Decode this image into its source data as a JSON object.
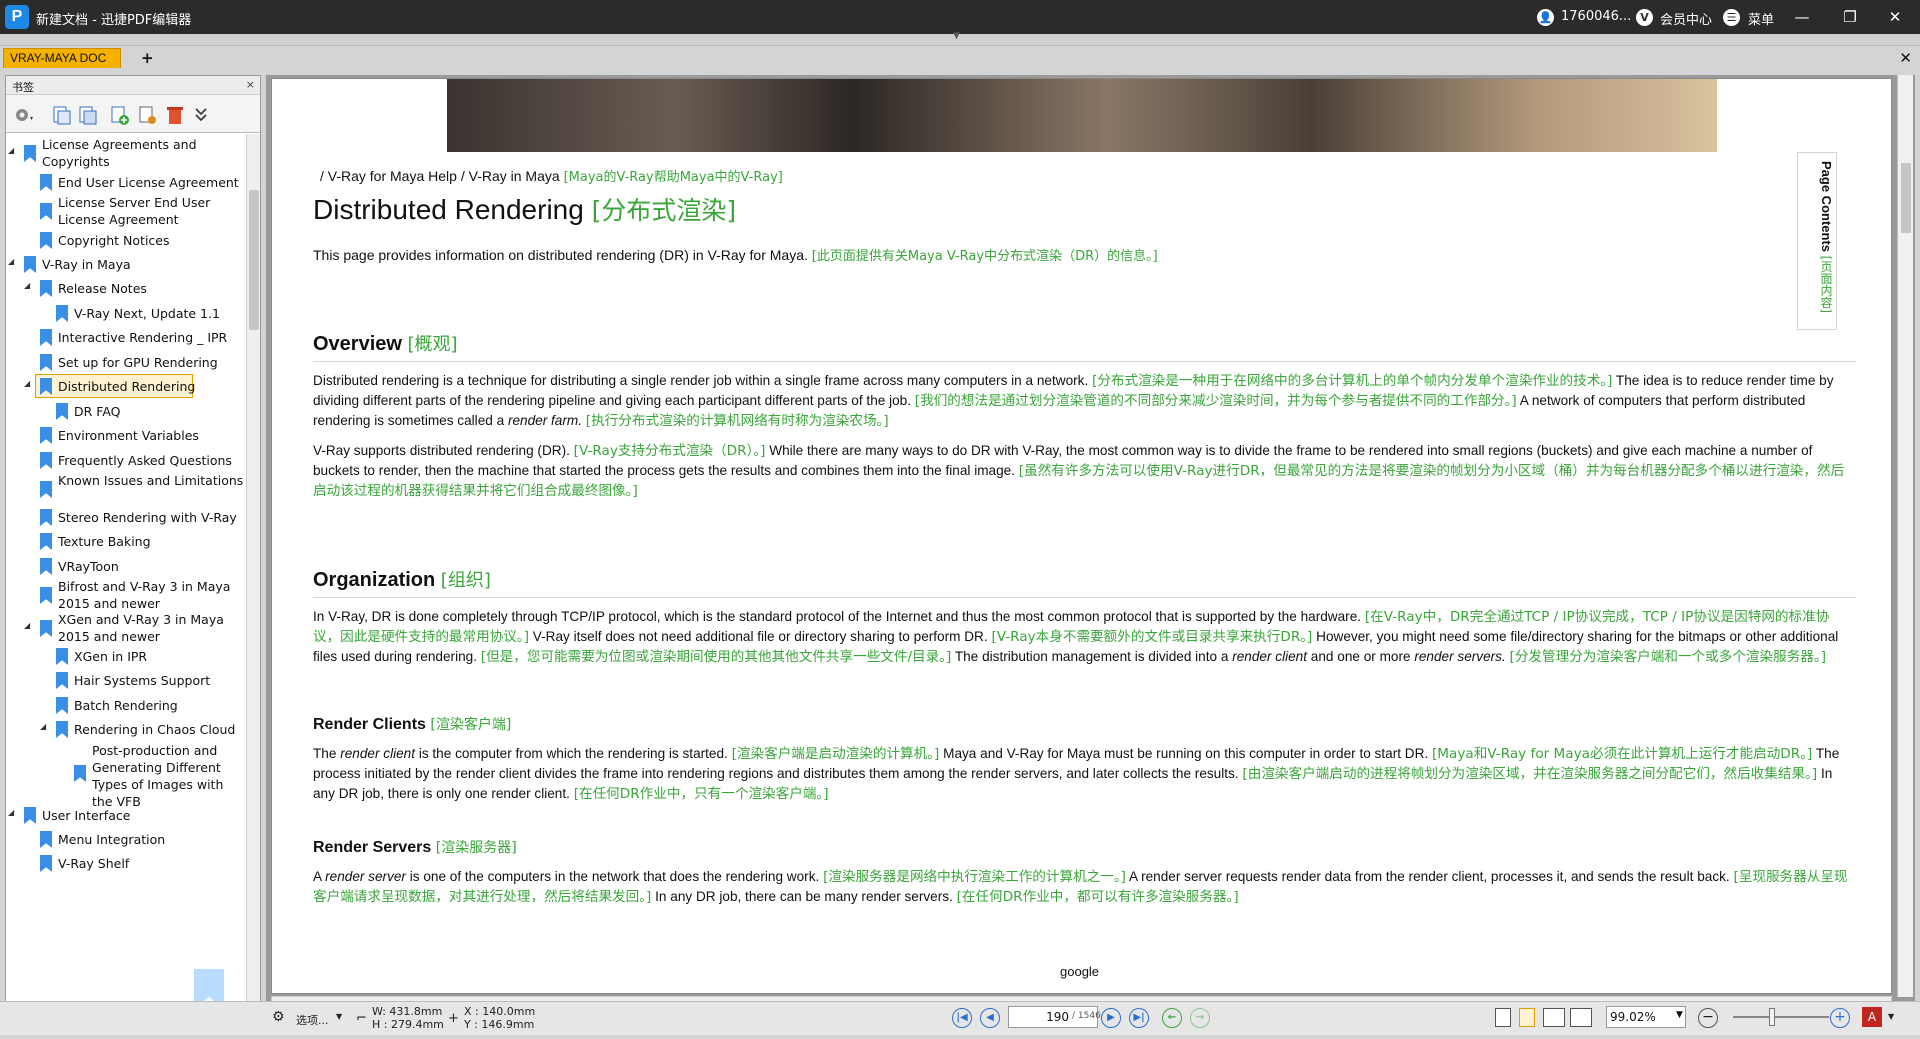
{
  "titlebar": {
    "app_logo": "P",
    "title": "新建文档 - 迅捷PDF编辑器",
    "user_id": "1760046...",
    "vip_badge": "V",
    "member_center": "会员中心",
    "menu_label": "菜单",
    "minimize": "—",
    "restore": "❐",
    "close": "✕"
  },
  "tabs": {
    "doc_tab": "VRAY-MAYA DOC",
    "new_tab": "+",
    "close_all": "✕"
  },
  "bookmarks": {
    "panel_title": "书签",
    "close": "×",
    "items": [
      {
        "label": "License Agreements and Copyrights",
        "level": 0,
        "expanded": true
      },
      {
        "label": "End User License Agreement",
        "level": 1
      },
      {
        "label": "License Server End User License Agreement",
        "level": 1
      },
      {
        "label": "Copyright Notices",
        "level": 1
      },
      {
        "label": "V-Ray in Maya",
        "level": 0,
        "expanded": true
      },
      {
        "label": "Release Notes",
        "level": 1,
        "expanded": true
      },
      {
        "label": "V-Ray Next, Update 1.1",
        "level": 2
      },
      {
        "label": "Interactive Rendering _ IPR",
        "level": 1
      },
      {
        "label": "Set up for GPU Rendering",
        "level": 1
      },
      {
        "label": "Distributed Rendering",
        "level": 1,
        "expanded": true,
        "selected": true
      },
      {
        "label": "DR FAQ",
        "level": 2
      },
      {
        "label": "Environment Variables",
        "level": 1
      },
      {
        "label": "Frequently Asked Questions",
        "level": 1
      },
      {
        "label": "Known Issues and Limitations",
        "level": 1
      },
      {
        "label": "Stereo Rendering with V-Ray",
        "level": 1
      },
      {
        "label": "Texture Baking",
        "level": 1
      },
      {
        "label": "VRayToon",
        "level": 1
      },
      {
        "label": "Bifrost and V-Ray 3 in Maya 2015 and newer",
        "level": 1
      },
      {
        "label": "XGen and V-Ray 3 in Maya 2015 and newer",
        "level": 1,
        "expanded": true
      },
      {
        "label": "XGen in IPR",
        "level": 2
      },
      {
        "label": "Hair Systems Support",
        "level": 2
      },
      {
        "label": "Batch Rendering",
        "level": 2
      },
      {
        "label": "Rendering in Chaos Cloud",
        "level": 2,
        "expanded": true
      },
      {
        "label": "Post-production and Generating Different Types of Images with the VFB",
        "level": 3
      },
      {
        "label": "User Interface",
        "level": 0,
        "expanded": true
      },
      {
        "label": "Menu Integration",
        "level": 1
      },
      {
        "label": "V-Ray Shelf",
        "level": 1
      }
    ]
  },
  "document": {
    "breadcrumb_sep1": "/",
    "breadcrumb_1": "V-Ray for Maya Help",
    "breadcrumb_sep2": "/",
    "breadcrumb_2": "V-Ray in Maya",
    "breadcrumb_cn": "[Maya的V-Ray帮助Maya中的V-Ray]",
    "title_en": "Distributed Rendering",
    "title_cn": "[分布式渲染]",
    "intro_en": "This page provides information on distributed rendering (DR) in V-Ray for Maya.",
    "intro_cn": "[此页面提供有关Maya V-Ray中分布式渲染（DR）的信息。]",
    "page_contents_en": "Page Contents",
    "page_contents_cn": "[页面内容]",
    "overview_en": "Overview",
    "overview_cn": "[概观]",
    "ov_p1_a": "Distributed rendering is a technique for distributing a single render job within a single frame across many computers in a network.",
    "ov_p1_b": "[分布式渲染是一种用于在网络中的多台计算机上的单个帧内分发单个渲染作业的技术。]",
    "ov_p1_c": "The idea is to reduce render time by dividing different parts of the rendering pipeline and giving each participant different parts of the job.",
    "ov_p1_d": "[我们的想法是通过划分渲染管道的不同部分来减少渲染时间，并为每个参与者提供不同的工作部分。]",
    "ov_p1_e": "A network of computers that perform distributed rendering is sometimes called a",
    "ov_p1_f": "render farm.",
    "ov_p1_g": "[执行分布式渲染的计算机网络有时称为渲染农场。]",
    "ov_p2_a": "V-Ray supports distributed rendering (DR).",
    "ov_p2_b": "[V-Ray支持分布式渲染（DR）。]",
    "ov_p2_c": "While there are many ways to do DR with V-Ray, the most common way is to divide the frame to be rendered into small regions (buckets) and give each machine a number of buckets to render, then the machine that started the process gets the results and combines them into the final image.",
    "ov_p2_d": "[虽然有许多方法可以使用V-Ray进行DR，但最常见的方法是将要渲染的帧划分为小区域（桶）并为每台机器分配多个桶以进行渲染，然后启动该过程的机器获得结果并将它们组合成最终图像。]",
    "org_en": "Organization",
    "org_cn": "[组织]",
    "org_p_a": "In V-Ray, DR is done completely through TCP/IP protocol, which is the standard protocol of the Internet and thus the most common protocol that is supported by the hardware.",
    "org_p_b": "[在V-Ray中，DR完全通过TCP / IP协议完成，TCP / IP协议是因特网的标准协议，因此是硬件支持的最常用协议。]",
    "org_p_c": "V-Ray itself does not need additional file or directory sharing to perform DR.",
    "org_p_d": "[V-Ray本身不需要额外的文件或目录共享来执行DR。]",
    "org_p_e": "However, you might need some file/directory sharing for the bitmaps or other additional files used during rendering.",
    "org_p_f": "[但是，您可能需要为位图或渲染期间使用的其他其他文件共享一些文件/目录。]",
    "org_p_g": "The distribution management is divided into a",
    "org_p_h": "render client",
    "org_p_i": "and one or more",
    "org_p_j": "render servers.",
    "org_p_k": "[分发管理分为渲染客户端和一个或多个渲染服务器。]",
    "rc_en": "Render Clients",
    "rc_cn": "[渲染客户端]",
    "rc_p_a": "The",
    "rc_p_b": "render client",
    "rc_p_c": "is the computer from which the rendering is started.",
    "rc_p_d": "[渲染客户端是启动渲染的计算机。]",
    "rc_p_e": "Maya and V-Ray for Maya must be running on this computer in order to start DR.",
    "rc_p_f": "[Maya和V-Ray for Maya必须在此计算机上运行才能启动DR。]",
    "rc_p_g": "The process initiated by the render client divides the frame into rendering regions and distributes them among the render servers, and later collects the results.",
    "rc_p_h": "[由渲染客户端启动的进程将帧划分为渲染区域，并在渲染服务器之间分配它们，然后收集结果。]",
    "rc_p_i": "In any DR job, there is only one render client.",
    "rc_p_j": "[在任何DR作业中，只有一个渲染客户端。]",
    "rs_en": "Render Servers",
    "rs_cn": "[渲染服务器]",
    "rs_p_a": "A",
    "rs_p_b": "render server",
    "rs_p_c": "is one of the computers in the network that does the rendering work.",
    "rs_p_d": "[渲染服务器是网络中执行渲染工作的计算机之一。]",
    "rs_p_e": "A render server requests render data from the render client, processes it, and sends the result back.",
    "rs_p_f": "[呈现服务器从呈现客户端请求呈现数据，对其进行处理，然后将结果发回。]",
    "rs_p_g": "In any DR job, there can be many render servers.",
    "rs_p_h": "[在任何DR作业中，都可以有许多渲染服务器。]",
    "footer": "google"
  },
  "statusbar": {
    "options_label": "选项...",
    "width": "W: 431.8mm",
    "height": "H : 279.4mm",
    "x": "X : 140.0mm",
    "y": "Y : 146.9mm",
    "current_page": "190",
    "total_pages": "/ 1546",
    "zoom": "99.02%",
    "first": "|◀",
    "prev": "◀",
    "next": "▶",
    "last": "▶|",
    "back": "←",
    "forward": "→",
    "zoom_out": "−",
    "zoom_in": "+",
    "pdf_icon": "A"
  },
  "colors": {
    "accent_tab": "#f5b100",
    "chinese_text": "#3aa63a",
    "bookmark_flag": "#3a8ee6",
    "titlebar": "#2b2b2b"
  }
}
